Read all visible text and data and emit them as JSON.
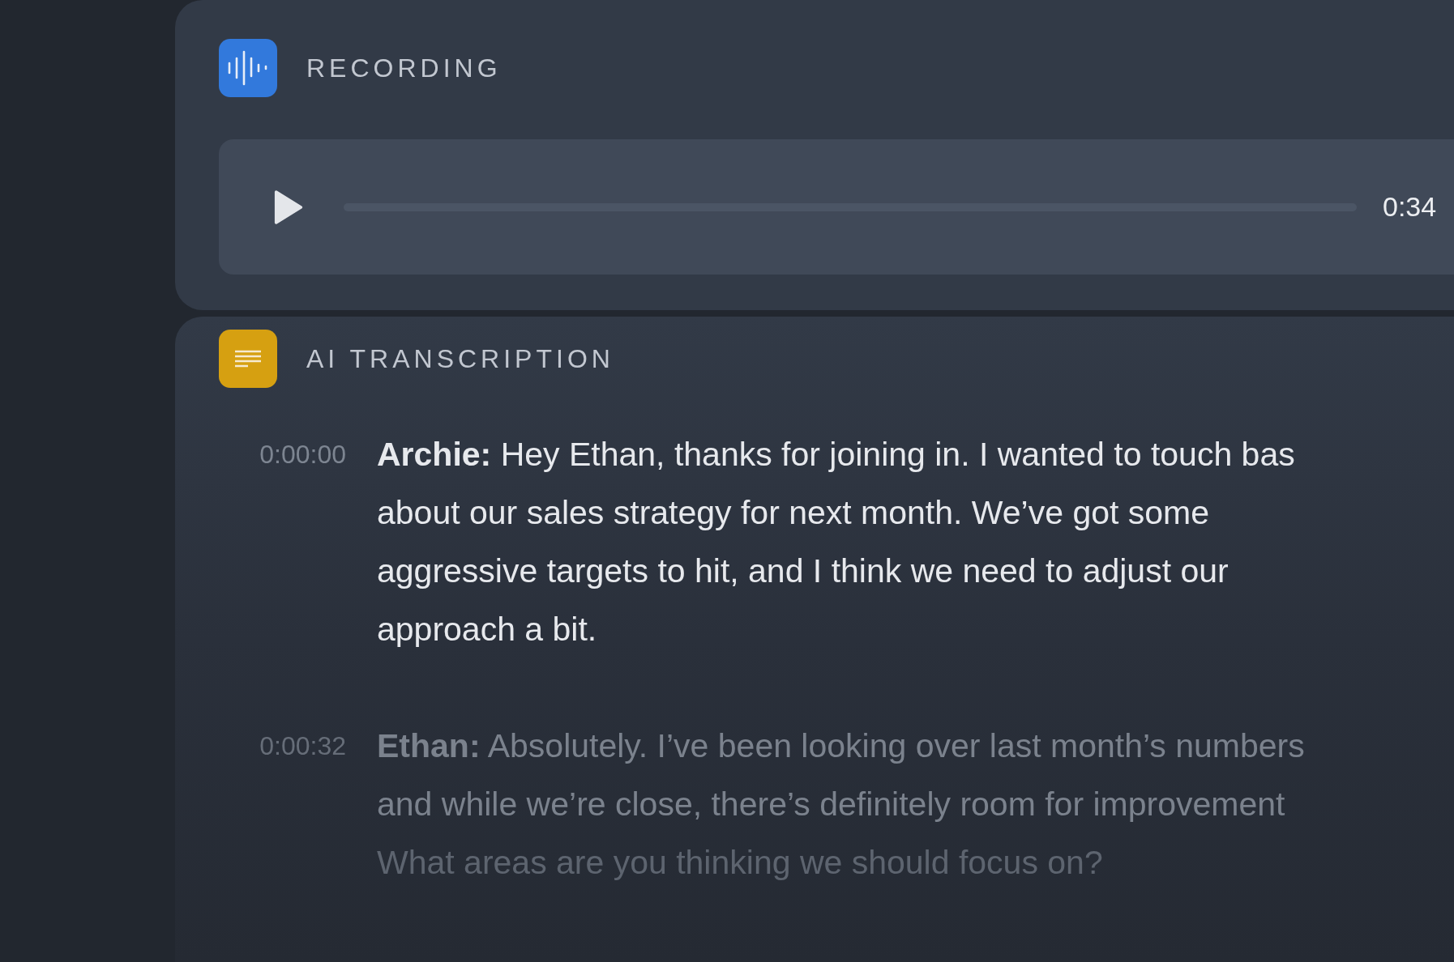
{
  "recording": {
    "title": "RECORDING",
    "player": {
      "level": 0,
      "time": "0:34"
    }
  },
  "transcription": {
    "title": "AI TRANSCRIPTION",
    "entries": [
      {
        "time": "0:00:00",
        "lines": [
          "**Archie:** Hey Ethan, thanks for joining in. I wanted to touch bas",
          "about our sales strategy for next month. We’ve got some",
          "aggressive targets to hit, and I think we need to adjust our",
          "approach a bit."
        ]
      },
      {
        "time": "0:00:32",
        "lines": [
          "**Ethan:** Absolutely. I’ve been looking over last month’s numbers",
          "and while we’re close, there’s definitely room for improvement",
          "What areas are you thinking we should focus on?"
        ]
      }
    ]
  }
}
